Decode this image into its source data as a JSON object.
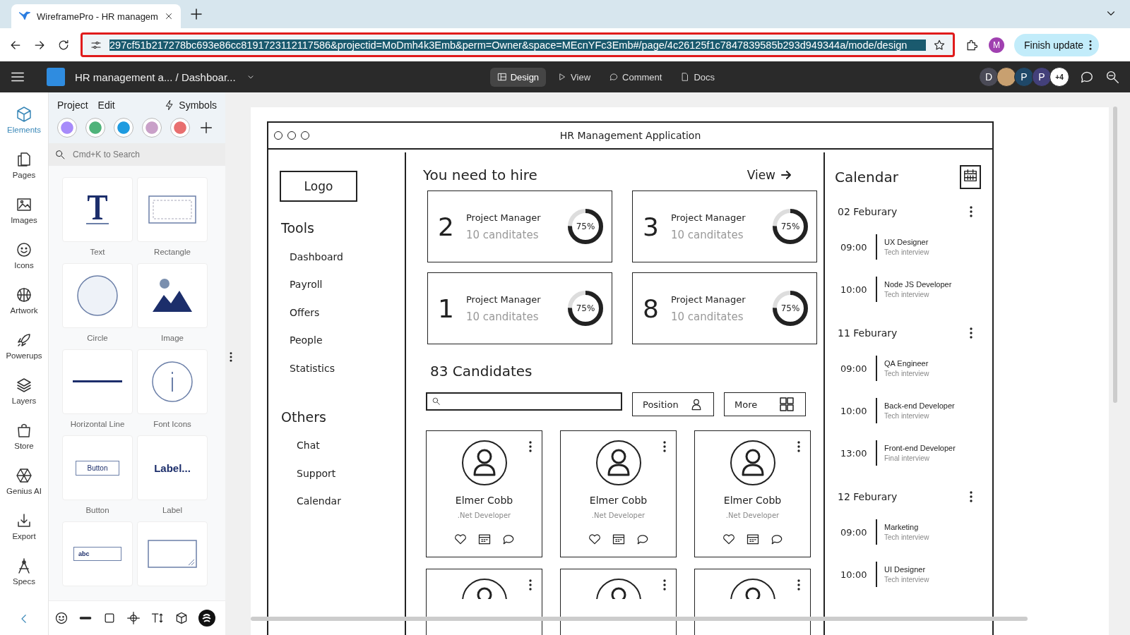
{
  "browser": {
    "tab_title": "WireframePro - HR managem",
    "url": "297cf51b217278bc693e86cc8191723112117586&projectid=MoDmh4k3Emb&perm=Owner&space=MEcnYFc3Emb#/page/4c26125f1c7847839585b293d949344a/mode/design",
    "profile": "M",
    "update_button": "Finish update"
  },
  "app": {
    "breadcrumb": "HR management a... / Dashboar...",
    "modes": [
      {
        "label": "Design",
        "selected": true
      },
      {
        "label": "View",
        "selected": false
      },
      {
        "label": "Comment",
        "selected": false
      },
      {
        "label": "Docs",
        "selected": false
      }
    ],
    "collaborators": [
      {
        "kind": "letter",
        "initial": "D",
        "color": "#4b4b57"
      },
      {
        "kind": "photo"
      },
      {
        "kind": "letter",
        "initial": "P",
        "color": "#1f4868"
      },
      {
        "kind": "letter",
        "initial": "P",
        "color": "#43407a"
      },
      {
        "kind": "count",
        "initial": "+4"
      }
    ]
  },
  "rail": [
    {
      "label": "Elements",
      "selected": true
    },
    {
      "label": "Pages",
      "selected": false
    },
    {
      "label": "Images",
      "selected": false
    },
    {
      "label": "Icons",
      "selected": false
    },
    {
      "label": "Artwork",
      "selected": false
    },
    {
      "label": "Powerups",
      "selected": false
    },
    {
      "label": "Layers",
      "selected": false
    },
    {
      "label": "Store",
      "selected": false
    },
    {
      "label": "Genius AI",
      "selected": false
    },
    {
      "label": "Export",
      "selected": false
    },
    {
      "label": "Specs",
      "selected": false
    }
  ],
  "panel": {
    "menus": [
      "Project",
      "Edit"
    ],
    "symbols": "Symbols",
    "search_placeholder": "Cmd+K to Search",
    "tiles": [
      {
        "kind": "text",
        "label": "Text"
      },
      {
        "kind": "rectangle",
        "label": "Rectangle"
      },
      {
        "kind": "circle",
        "label": "Circle"
      },
      {
        "kind": "image",
        "label": "Image"
      },
      {
        "kind": "hline",
        "label": "Horizontal Line"
      },
      {
        "kind": "fonticon",
        "label": "Font Icons"
      },
      {
        "kind": "button",
        "label": "Button",
        "sample": "Button"
      },
      {
        "kind": "label",
        "label": "Label",
        "sample": "Label..."
      },
      {
        "kind": "textinput",
        "sample": "abc"
      },
      {
        "kind": "textarea"
      }
    ]
  },
  "wireframe": {
    "title": "HR Management Application",
    "logo": "Logo",
    "sections": [
      {
        "heading": "Tools",
        "items": [
          "Dashboard",
          "Payroll",
          "Offers",
          "People",
          "Statistics"
        ]
      },
      {
        "heading": "Others",
        "items": [
          "Chat",
          "Support",
          "Calendar"
        ]
      }
    ],
    "hire": {
      "heading": "You need to hire",
      "view_link": "View",
      "cards": [
        {
          "count": "2",
          "title": "Project Manager",
          "subtitle": "10 canditates",
          "level": 0.75,
          "reading": "75%"
        },
        {
          "count": "3",
          "title": "Project Manager",
          "subtitle": "10 canditates",
          "level": 0.75,
          "reading": "75%"
        },
        {
          "count": "1",
          "title": "Project Manager",
          "subtitle": "10 canditates",
          "level": 0.75,
          "reading": "75%"
        },
        {
          "count": "8",
          "title": "Project Manager",
          "subtitle": "10 canditates",
          "level": 0.75,
          "reading": "75%"
        }
      ]
    },
    "candidates": {
      "heading": "83 Candidates",
      "position_button": "Position",
      "more_button": "More",
      "cards": [
        {
          "kind": "full",
          "name": "Elmer Cobb",
          "role": ".Net Developer"
        },
        {
          "kind": "full",
          "name": "Elmer Cobb",
          "role": ".Net Developer"
        },
        {
          "kind": "full",
          "name": "Elmer Cobb",
          "role": ".Net Developer"
        },
        {
          "kind": "cut"
        },
        {
          "kind": "cut"
        },
        {
          "kind": "cut"
        }
      ]
    },
    "calendar": {
      "heading": "Calendar",
      "days": [
        {
          "date": "02 Feburary",
          "events": [
            {
              "time": "09:00",
              "title": "UX Designer",
              "type": "Tech interview"
            },
            {
              "time": "10:00",
              "title": "Node JS Developer",
              "type": "Tech interview"
            }
          ]
        },
        {
          "date": "11 Feburary",
          "events": [
            {
              "time": "09:00",
              "title": "QA Engineer",
              "type": "Tech interview"
            },
            {
              "time": "10:00",
              "title": "Back-end Developer",
              "type": "Tech interview"
            },
            {
              "time": "13:00",
              "title": "Front-end Developer",
              "type": "Final interview"
            }
          ]
        },
        {
          "date": "12 Feburary",
          "events": [
            {
              "time": "09:00",
              "title": "Marketing",
              "type": "Tech interview"
            },
            {
              "time": "10:00",
              "title": "UI Designer",
              "type": "Tech interview"
            }
          ]
        }
      ]
    }
  }
}
